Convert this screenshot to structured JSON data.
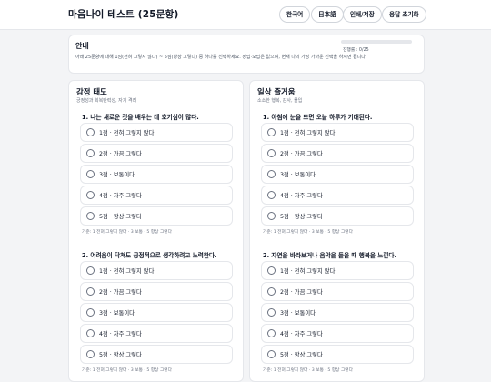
{
  "header": {
    "title": "마음나이 테스트 (25문항)",
    "buttons": [
      "한국어",
      "日本語",
      "인쇄/저장",
      "응답 초기화"
    ]
  },
  "info": {
    "title": "안내",
    "text": "아래 25문항에 대해 1점(전혀 그렇지 않다) ~ 5점(항상 그렇다) 중 하나를 선택하세요. 정답·오답은 없으며, 현재 나의 가장 가까운 선택을 하시면 됩니다.",
    "progress_label": "진행률 : 0/25",
    "progress_fraction": 0
  },
  "options": [
    "1점 · 전혀 그렇지 않다",
    "2점 · 가끔 그렇다",
    "3점 · 보통이다",
    "4점 · 자주 그렇다",
    "5점 · 항상 그렇다"
  ],
  "legend": "기준: 1 전혀 그렇지 않다 · 3 보통 · 5 항상 그렇다",
  "sections": [
    {
      "title": "감정 태도",
      "subtitle": "긍정성과 회복탄력성, 자기 격려",
      "questions": [
        "1. 나는 새로운 것을 배우는 데 호기심이 많다.",
        "2. 어려움이 닥쳐도 긍정적으로 생각하려고 노력한다."
      ]
    },
    {
      "title": "일상 즐거움",
      "subtitle": "소소한 행복, 감사, 몰입",
      "questions": [
        "1. 아침에 눈을 뜨면 오늘 하루가 기대된다.",
        "2. 자연을 바라보거나 음악을 들을 때 행복을 느낀다."
      ]
    }
  ]
}
